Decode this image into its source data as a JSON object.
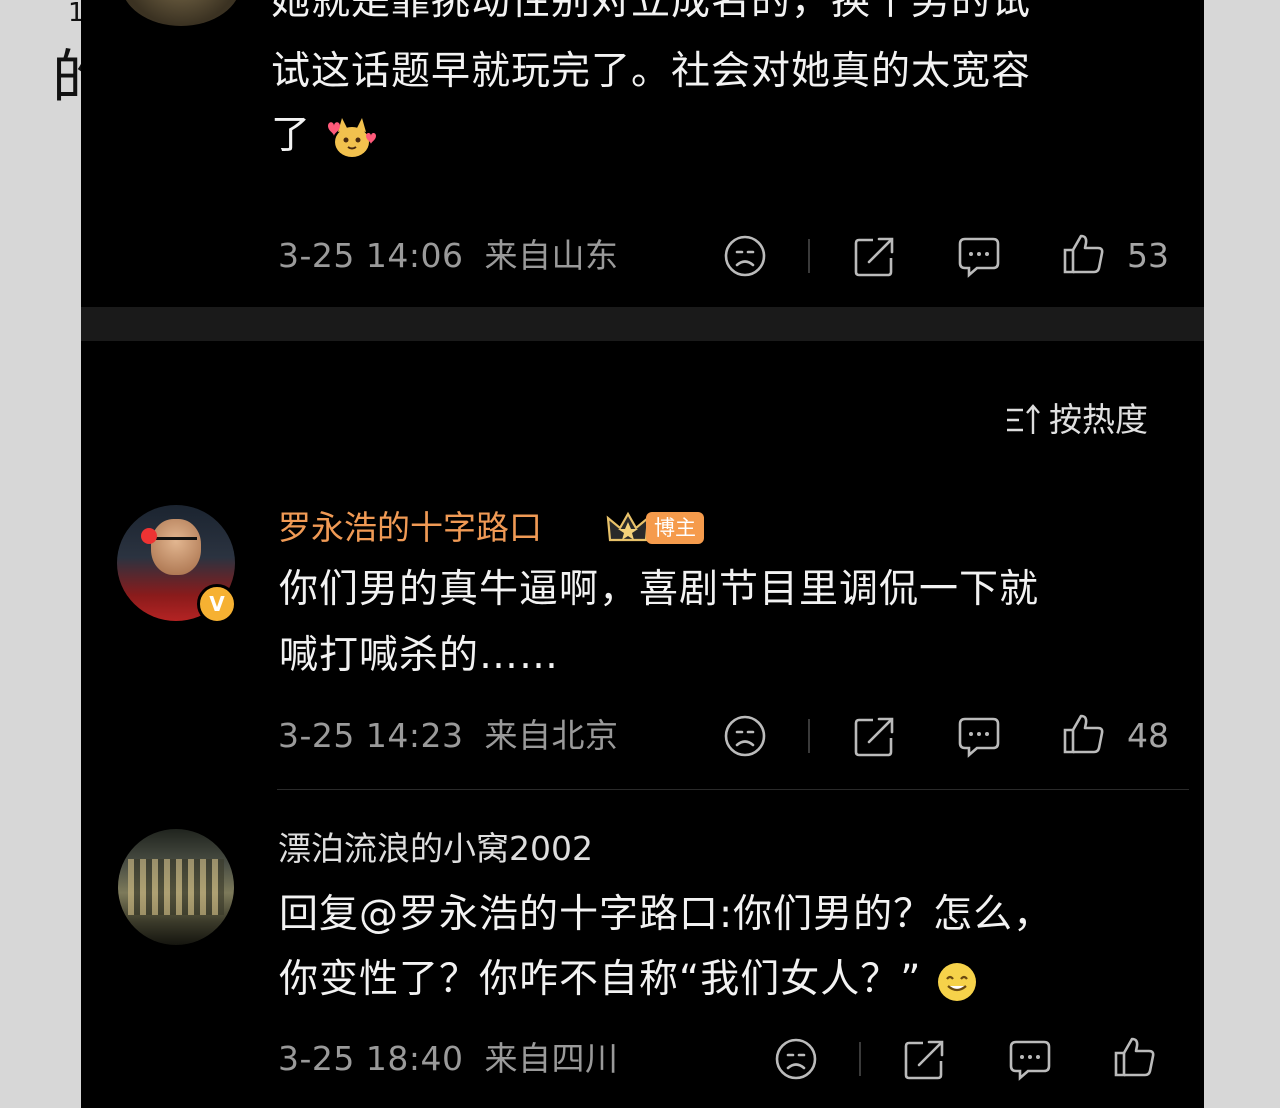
{
  "background": {
    "glyph": "的"
  },
  "comment_top": {
    "text_line1": "她就是靠挑动性别对立成名的，换个男的试",
    "text_line2": "试这话题早就玩完了。社会对她真的太宽容",
    "text_line3": "了",
    "emoji": "cat-love-emoji",
    "time": "3-25 14:06",
    "location": "来自山东",
    "likes": "53"
  },
  "sort": {
    "label": "按热度",
    "icon": "sort-icon"
  },
  "comment_luo": {
    "username": "罗永浩的十字路口",
    "badge": "博主",
    "verified": "V",
    "text_line1": "你们男的真牛逼啊，喜剧节目里调侃一下就",
    "text_line2": "喊打喊杀的……",
    "time": "3-25 14:23",
    "location": "来自北京",
    "likes": "48"
  },
  "comment_reply": {
    "username": "漂泊流浪的小窝2002",
    "text_line1": "回复@罗永浩的十字路口:你们男的？怎么，",
    "text_line2": "你变性了？你咋不自称“我们女人？”",
    "emoji": "smile-emoji",
    "time": "3-25 18:40",
    "location": "来自四川"
  },
  "colors": {
    "background": "#000000",
    "text": "#f2f2f2",
    "meta": "#9a9a9a",
    "accent_orange": "#f09a55",
    "badge_orange": "#f59b4c",
    "vip_gold": "#f6b132"
  },
  "actions": [
    "sad-face-icon",
    "share-icon",
    "comment-icon",
    "like-icon"
  ]
}
